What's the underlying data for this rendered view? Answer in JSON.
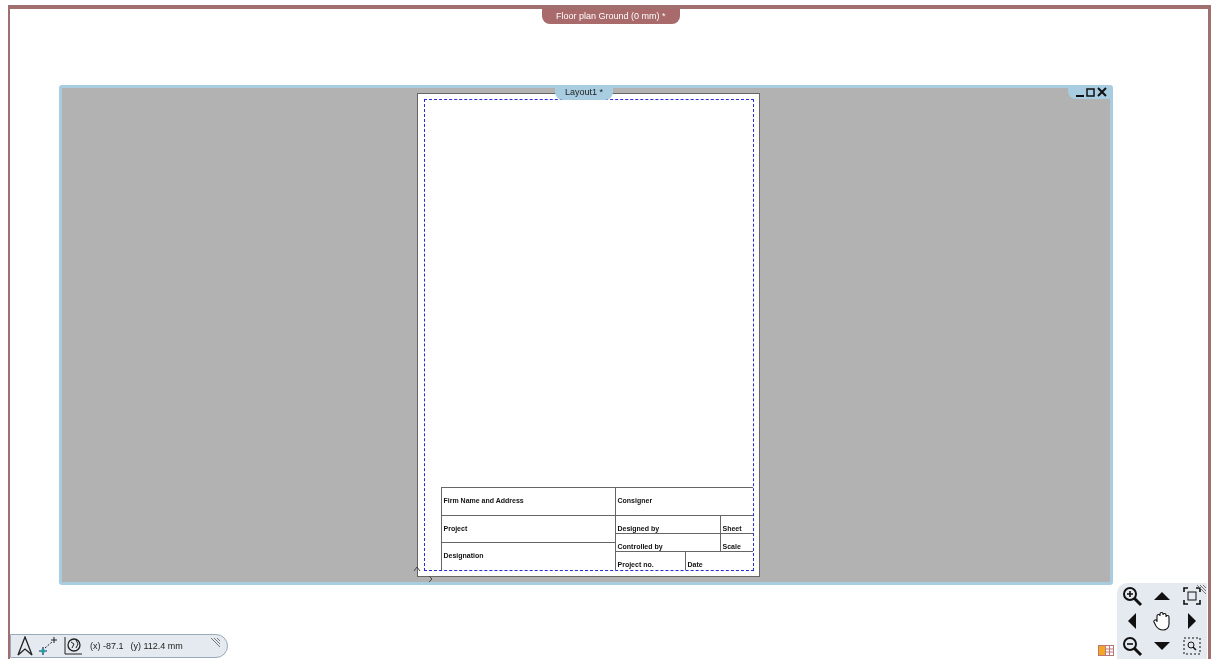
{
  "document_tab": {
    "title": "Floor plan Ground (0 mm) *"
  },
  "layout_window": {
    "title": "Layout1 *"
  },
  "title_block": {
    "left": [
      {
        "label": "Firm Name and Address"
      },
      {
        "label": "Project"
      },
      {
        "label": "Designation"
      }
    ],
    "right": [
      {
        "label": "Consigner"
      },
      {
        "label": "Designed by",
        "side": "Sheet"
      },
      {
        "label": "Controlled by",
        "side": "Scale"
      },
      {
        "label": "Project no.",
        "side": "Date"
      }
    ]
  },
  "status_bar": {
    "x": "(x) -87.1",
    "y": "(y) 112.4 mm"
  }
}
